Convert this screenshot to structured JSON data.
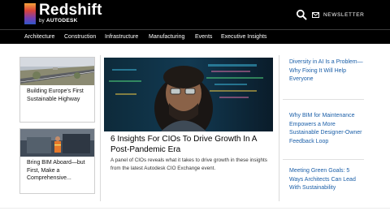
{
  "header": {
    "brand": "Redshift",
    "by_prefix": "by",
    "by_company": "AUTODESK",
    "newsletter_label": "NEWSLETTER",
    "icons": [
      "search-icon",
      "mail-icon"
    ]
  },
  "nav": {
    "items": [
      "Architecture",
      "Construction",
      "Infrastructure",
      "Manufacturing",
      "Events",
      "Executive Insights"
    ]
  },
  "left_cards": [
    {
      "title": "Building Europe's First Sustainable Highway"
    },
    {
      "title": "Bring BIM Aboard—but First, Make a Comprehensive..."
    }
  ],
  "feature": {
    "title": "6 Insights For CIOs To Drive Growth In A Post-Pandemic Era",
    "description": "A panel of CIOs reveals what it takes to drive growth in these insights from the latest Autodesk CIO Exchange event."
  },
  "sidebar": {
    "links": [
      "Diversity in AI Is a Problem—Why Fixing It Will Help Everyone",
      "Why BIM for Maintenance Empowers a More Sustainable Designer-Owner Feedback Loop",
      "Meeting Green Goals: 5 Ways Architects Can Lead With Sustainability"
    ]
  },
  "colors": {
    "header_bg": "#000000",
    "link_blue": "#1b5fa8",
    "brand_gradient": [
      "#f6a33a",
      "#d8423a",
      "#7a3fb0",
      "#2f57c8"
    ]
  }
}
